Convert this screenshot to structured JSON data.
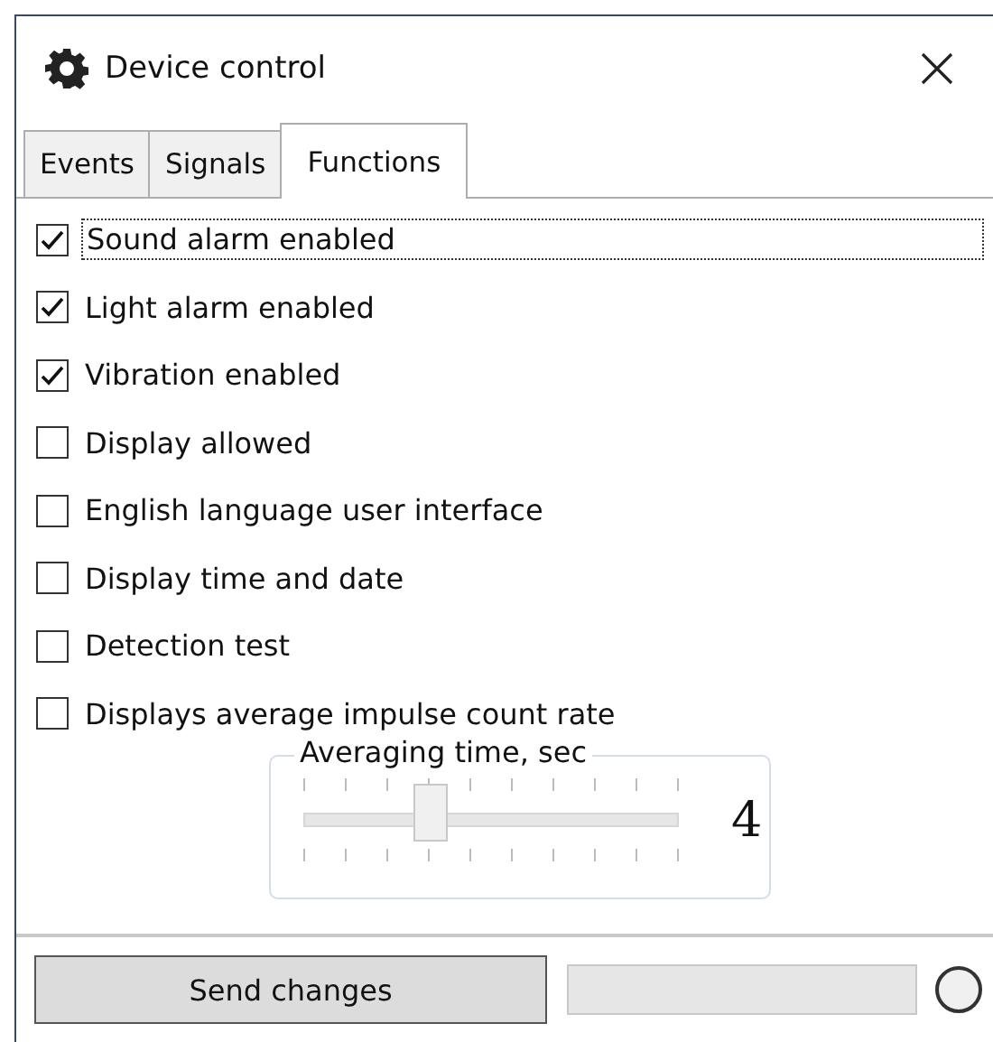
{
  "window": {
    "title": "Device control"
  },
  "tabs": [
    {
      "label": "Events",
      "selected": false
    },
    {
      "label": "Signals",
      "selected": false
    },
    {
      "label": "Functions",
      "selected": true
    }
  ],
  "options": [
    {
      "label": "Sound alarm enabled",
      "checked": true,
      "focused": true
    },
    {
      "label": "Light alarm enabled",
      "checked": true,
      "focused": false
    },
    {
      "label": "Vibration enabled",
      "checked": true,
      "focused": false
    },
    {
      "label": "Display allowed",
      "checked": false,
      "focused": false
    },
    {
      "label": "English language user interface",
      "checked": false,
      "focused": false
    },
    {
      "label": "Display time and date",
      "checked": false,
      "focused": false
    },
    {
      "label": "Detection test",
      "checked": false,
      "focused": false
    },
    {
      "label": "Displays average impulse count rate",
      "checked": false,
      "focused": false
    }
  ],
  "averaging": {
    "title": "Averaging time, sec",
    "level": 0.333,
    "reading": "4"
  },
  "footer": {
    "button": "Send changes",
    "status_on": false
  }
}
